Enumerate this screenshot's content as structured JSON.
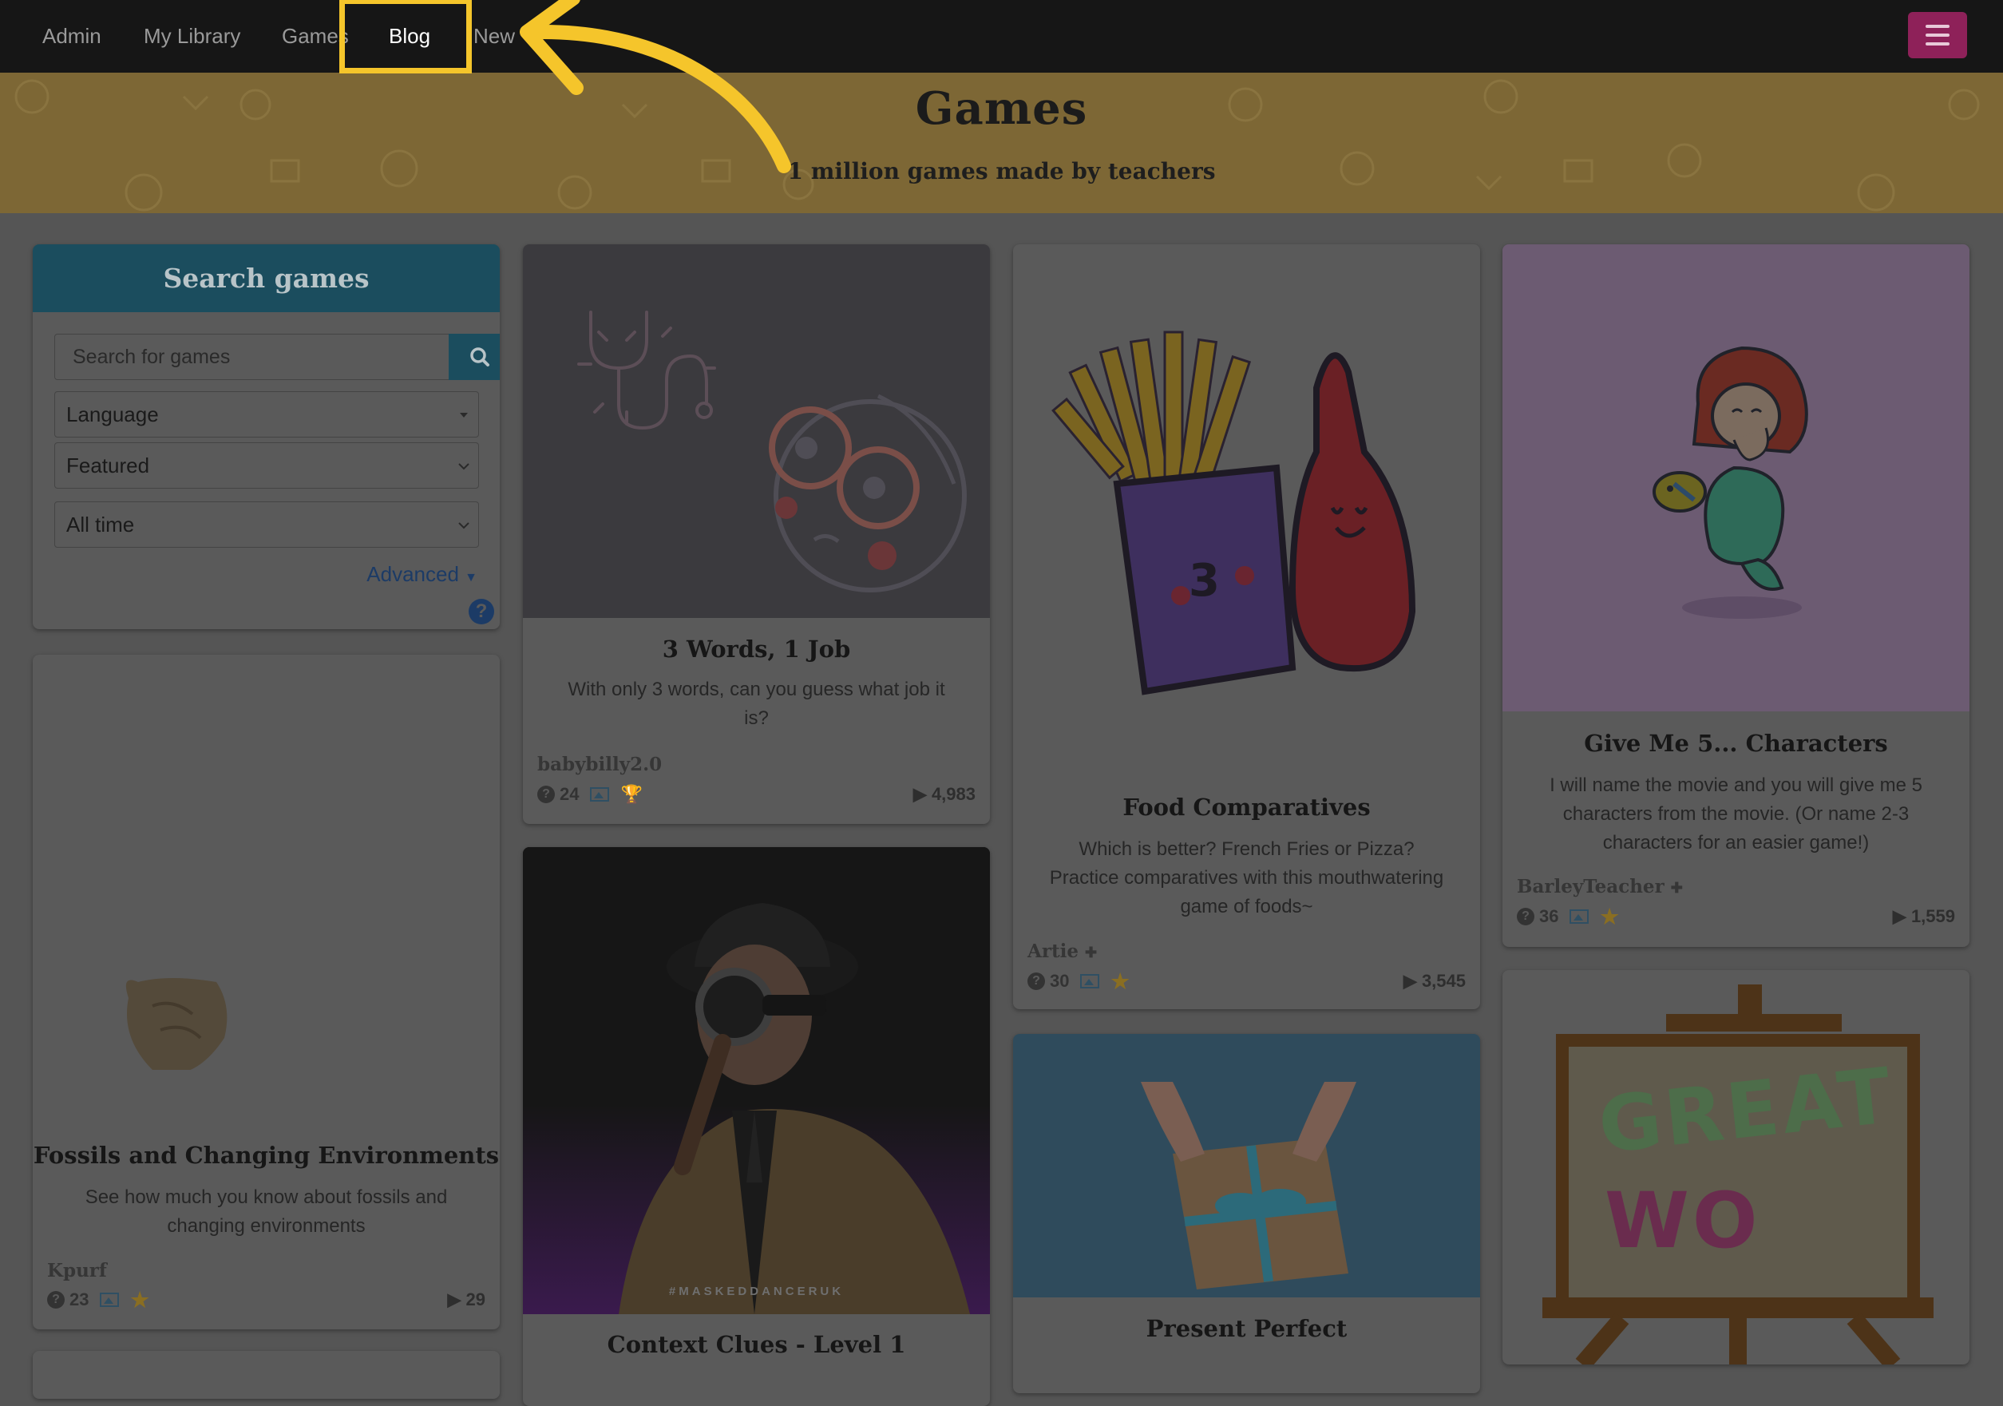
{
  "nav": {
    "items": [
      {
        "label": "Admin"
      },
      {
        "label": "My Library"
      },
      {
        "label": "Games"
      },
      {
        "label": "Blog"
      },
      {
        "label": "New"
      }
    ],
    "active": "Blog"
  },
  "banner": {
    "title": "Games",
    "subtitle": "1 million games made by teachers"
  },
  "search": {
    "header": "Search games",
    "placeholder": "Search for games",
    "language": "Language",
    "sort": "Featured",
    "time": "All time",
    "advanced": "Advanced",
    "help": "?"
  },
  "games": [
    {
      "title": "Fossils and Changing Environments",
      "description": "See how much you know about fossils and changing environments",
      "author": "Kpurf",
      "questions": "23",
      "plays": "29",
      "badge": "star-icon"
    },
    {
      "title": "3 Words, 1 Job",
      "description": "With only 3 words, can you guess what job it is?",
      "author": "babybilly2.0",
      "questions": "24",
      "plays": "4,983",
      "badge": "trophy-icon"
    },
    {
      "title": "Context Clues - Level 1",
      "watermark": "#MASKEDDANCERUK"
    },
    {
      "title": "Food Comparatives",
      "description": "Which is better? French Fries or Pizza? Practice comparatives with this mouthwatering game of foods~",
      "author": "Artie",
      "questions": "30",
      "plays": "3,545",
      "badge": "star-icon"
    },
    {
      "title": "Present Perfect"
    },
    {
      "title": "Give Me 5... Characters",
      "description": "I will name the movie and you will give me 5 characters from the movie. (Or name 2-3 characters for an easier game!)",
      "author": "BarleyTeacher",
      "questions": "36",
      "plays": "1,559",
      "badge": "star-icon"
    },
    {
      "sign_text_1": "GREAT",
      "sign_text_2": "WO"
    }
  ],
  "colors": {
    "highlight": "#f5c52b",
    "banner": "#7d6735",
    "search_header": "#1b4d5e",
    "menu_button": "#8e2159"
  },
  "glyphs": {
    "add": "✚",
    "play": "▶",
    "star": "★",
    "trophy": "🏆"
  }
}
